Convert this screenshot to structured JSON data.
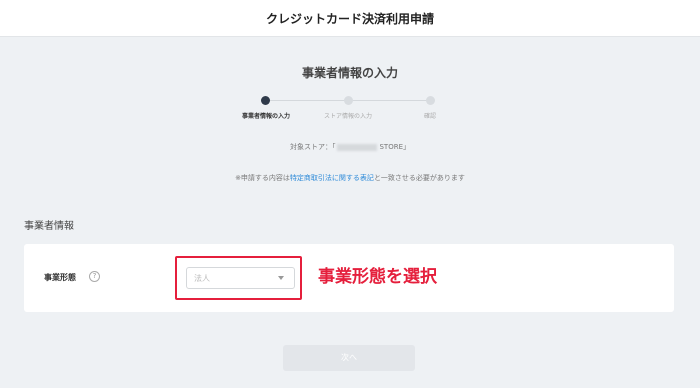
{
  "header": {
    "title": "クレジットカード決済利用申請"
  },
  "page": {
    "heading": "事業者情報の入力"
  },
  "stepper": {
    "steps": [
      {
        "label": "事業者情報の入力",
        "active": true
      },
      {
        "label": "ストア情報の入力",
        "active": false
      },
      {
        "label": "確認",
        "active": false
      }
    ]
  },
  "store": {
    "prefix": "対象ストア：「",
    "name_suffix": "STORE」"
  },
  "notice": {
    "before": "※申請する内容は",
    "link": "特定商取引法に関する表記",
    "after": "と一致させる必要があります"
  },
  "section": {
    "title": "事業者情報"
  },
  "form": {
    "business_type": {
      "label": "事業形態",
      "help_icon": "?",
      "placeholder": "法人"
    }
  },
  "annotation": {
    "text": "事業形態を選択",
    "color": "#e51f3c"
  },
  "actions": {
    "next_label": "次へ"
  }
}
